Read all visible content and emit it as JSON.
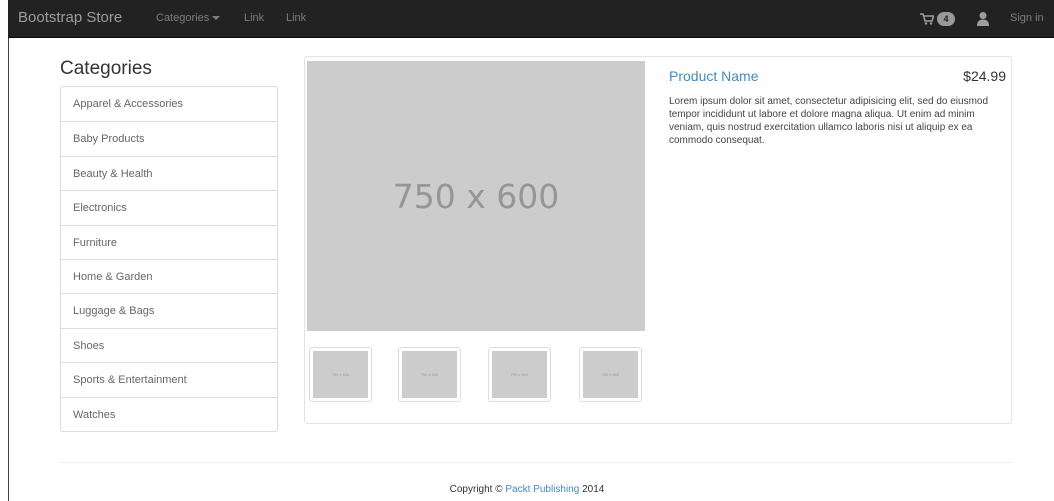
{
  "navbar": {
    "brand": "Bootstrap Store",
    "categories_label": "Categories",
    "link1": "Link",
    "link2": "Link",
    "cart_count": "4",
    "sign_in": "Sign in",
    "icons": [
      "cart-icon",
      "user-icon",
      "caret-down-icon"
    ]
  },
  "sidebar": {
    "heading": "Categories",
    "items": [
      {
        "label": "Apparel & Accessories"
      },
      {
        "label": "Baby Products"
      },
      {
        "label": "Beauty & Health"
      },
      {
        "label": "Electronics"
      },
      {
        "label": "Furniture"
      },
      {
        "label": "Home & Garden"
      },
      {
        "label": "Luggage & Bags"
      },
      {
        "label": "Shoes"
      },
      {
        "label": "Sports & Entertainment"
      },
      {
        "label": "Watches"
      }
    ]
  },
  "product": {
    "image_placeholder": "750 x 600",
    "thumbnails": [
      "750 x 600",
      "750 x 600",
      "750 x 600",
      "750 x 600"
    ],
    "name": "Product Name",
    "price": "$24.99",
    "description": "Lorem ipsum dolor sit amet, consectetur adipisicing elit, sed do eiusmod tempor incididunt ut labore et dolore magna aliqua. Ut enim ad minim veniam, quis nostrud exercitation ullamco laboris nisi ut aliquip ex ea commodo consequat."
  },
  "footer": {
    "prefix": "Copyright © ",
    "publisher": "Packt Publishing",
    "year": " 2014"
  },
  "colors": {
    "navbar_bg": "#222222",
    "link": "#428bca",
    "placeholder_bg": "#cccccc"
  }
}
